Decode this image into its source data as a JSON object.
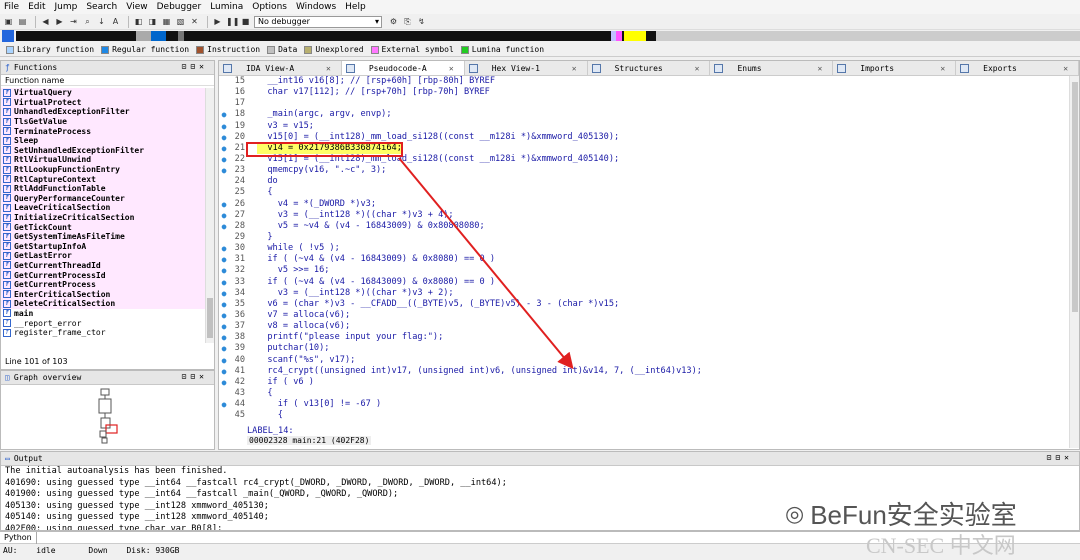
{
  "menu": [
    "File",
    "Edit",
    "Jump",
    "Search",
    "View",
    "Debugger",
    "Lumina",
    "Options",
    "Windows",
    "Help"
  ],
  "toolbar": {
    "debugger_select": "No debugger"
  },
  "legend": [
    {
      "label": "Library function",
      "color": "#aad4ff"
    },
    {
      "label": "Regular function",
      "color": "#1e88e5"
    },
    {
      "label": "Instruction",
      "color": "#a0522d"
    },
    {
      "label": "Data",
      "color": "#c0c0c0"
    },
    {
      "label": "Unexplored",
      "color": "#b8b070"
    },
    {
      "label": "External symbol",
      "color": "#ff77ff"
    },
    {
      "label": "Lumina function",
      "color": "#22cc22"
    }
  ],
  "functions_panel": {
    "title": "Functions",
    "column": "Function name",
    "items": [
      {
        "name": "VirtualQuery",
        "style": "import"
      },
      {
        "name": "VirtualProtect",
        "style": "import"
      },
      {
        "name": "UnhandledExceptionFilter",
        "style": "import"
      },
      {
        "name": "TlsGetValue",
        "style": "import"
      },
      {
        "name": "TerminateProcess",
        "style": "import"
      },
      {
        "name": "Sleep",
        "style": "import"
      },
      {
        "name": "SetUnhandledExceptionFilter",
        "style": "import"
      },
      {
        "name": "RtlVirtualUnwind",
        "style": "import"
      },
      {
        "name": "RtlLookupFunctionEntry",
        "style": "import"
      },
      {
        "name": "RtlCaptureContext",
        "style": "import"
      },
      {
        "name": "RtlAddFunctionTable",
        "style": "import"
      },
      {
        "name": "QueryPerformanceCounter",
        "style": "import"
      },
      {
        "name": "LeaveCriticalSection",
        "style": "import"
      },
      {
        "name": "InitializeCriticalSection",
        "style": "import"
      },
      {
        "name": "GetTickCount",
        "style": "import"
      },
      {
        "name": "GetSystemTimeAsFileTime",
        "style": "import"
      },
      {
        "name": "GetStartupInfoA",
        "style": "import"
      },
      {
        "name": "GetLastError",
        "style": "import"
      },
      {
        "name": "GetCurrentThreadId",
        "style": "import"
      },
      {
        "name": "GetCurrentProcessId",
        "style": "import"
      },
      {
        "name": "GetCurrentProcess",
        "style": "import"
      },
      {
        "name": "EnterCriticalSection",
        "style": "import"
      },
      {
        "name": "DeleteCriticalSection",
        "style": "import"
      },
      {
        "name": "main",
        "style": "sel"
      },
      {
        "name": "__report_error",
        "style": "plain"
      },
      {
        "name": "register_frame_ctor",
        "style": "plain"
      }
    ],
    "line_count": "Line 101 of 103"
  },
  "graph_panel": {
    "title": "Graph overview"
  },
  "tabs": [
    {
      "label": "IDA View-A",
      "active": false
    },
    {
      "label": "Pseudocode-A",
      "active": true
    },
    {
      "label": "Hex View-1",
      "active": false
    },
    {
      "label": "Structures",
      "active": false
    },
    {
      "label": "Enums",
      "active": false
    },
    {
      "label": "Imports",
      "active": false
    },
    {
      "label": "Exports",
      "active": false
    }
  ],
  "code_lines": [
    {
      "n": "15",
      "dot": false,
      "text": "  __int16 v16[8]; // [rsp+60h] [rbp-80h] BYREF"
    },
    {
      "n": "16",
      "dot": false,
      "text": "  char v17[112]; // [rsp+70h] [rbp-70h] BYREF"
    },
    {
      "n": "17",
      "dot": false,
      "text": ""
    },
    {
      "n": "18",
      "dot": true,
      "text": "  _main(argc, argv, envp);"
    },
    {
      "n": "19",
      "dot": true,
      "text": "  v3 = v15;"
    },
    {
      "n": "20",
      "dot": true,
      "text": "  v15[0] = (__int128)_mm_load_si128((const __m128i *)&xmmword_405130);"
    },
    {
      "n": "21",
      "dot": true,
      "text": "  v14 = 0x2179386B336874i64;",
      "hl": true
    },
    {
      "n": "22",
      "dot": true,
      "text": "  v15[1] = (__int128)_mm_load_si128((const __m128i *)&xmmword_405140);"
    },
    {
      "n": "23",
      "dot": true,
      "text": "  qmemcpy(v16, \".~c\", 3);"
    },
    {
      "n": "24",
      "dot": false,
      "text": "  do"
    },
    {
      "n": "25",
      "dot": false,
      "text": "  {"
    },
    {
      "n": "26",
      "dot": true,
      "text": "    v4 = *(_DWORD *)v3;"
    },
    {
      "n": "27",
      "dot": true,
      "text": "    v3 = (__int128 *)((char *)v3 + 4);"
    },
    {
      "n": "28",
      "dot": true,
      "text": "    v5 = ~v4 & (v4 - 16843009) & 0x80808080;"
    },
    {
      "n": "29",
      "dot": false,
      "text": "  }"
    },
    {
      "n": "30",
      "dot": true,
      "text": "  while ( !v5 );"
    },
    {
      "n": "31",
      "dot": true,
      "text": "  if ( (~v4 & (v4 - 16843009) & 0x8080) == 0 )"
    },
    {
      "n": "32",
      "dot": true,
      "text": "    v5 >>= 16;"
    },
    {
      "n": "33",
      "dot": true,
      "text": "  if ( (~v4 & (v4 - 16843009) & 0x8080) == 0 )"
    },
    {
      "n": "34",
      "dot": true,
      "text": "    v3 = (__int128 *)((char *)v3 + 2);"
    },
    {
      "n": "35",
      "dot": true,
      "text": "  v6 = (char *)v3 - __CFADD__((_BYTE)v5, (_BYTE)v5) - 3 - (char *)v15;"
    },
    {
      "n": "36",
      "dot": true,
      "text": "  v7 = alloca(v6);"
    },
    {
      "n": "37",
      "dot": true,
      "text": "  v8 = alloca(v6);"
    },
    {
      "n": "38",
      "dot": true,
      "text": "  printf(\"please input your flag:\");"
    },
    {
      "n": "39",
      "dot": true,
      "text": "  putchar(10);"
    },
    {
      "n": "40",
      "dot": true,
      "text": "  scanf(\"%s\", v17);"
    },
    {
      "n": "41",
      "dot": true,
      "text": "  rc4_crypt((unsigned int)v17, (unsigned int)v6, (unsigned int)&v14, 7, (__int64)v13);"
    },
    {
      "n": "42",
      "dot": true,
      "text": "  if ( v6 )"
    },
    {
      "n": "43",
      "dot": false,
      "text": "  {"
    },
    {
      "n": "44",
      "dot": true,
      "text": "    if ( v13[0] != -67 )"
    },
    {
      "n": "45",
      "dot": false,
      "text": "    {"
    }
  ],
  "label_line": "LABEL_14:",
  "status_addr": "00002328 main:21 (402F28)",
  "output_panel": {
    "title": "Output",
    "lines": [
      "The initial autoanalysis has been finished.",
      "401690: using guessed type __int64 __fastcall rc4_crypt(_DWORD, _DWORD, _DWORD, _DWORD, __int64);",
      "401900: using guessed type __int64 __fastcall _main(_QWORD, _QWORD, _QWORD);",
      "405130: using guessed type __int128 xmmword_405130;",
      "405140: using guessed type __int128 xmmword_405140;",
      "402F00: using guessed type char var_B0[8];"
    ]
  },
  "python_tab": "Python",
  "status": {
    "au": "AU:",
    "state": "idle",
    "dir": "Down",
    "disk": "Disk: 930GB"
  },
  "watermark": {
    "text": "BeFun安全实验室",
    "site": "CN-SEC 中文网"
  }
}
